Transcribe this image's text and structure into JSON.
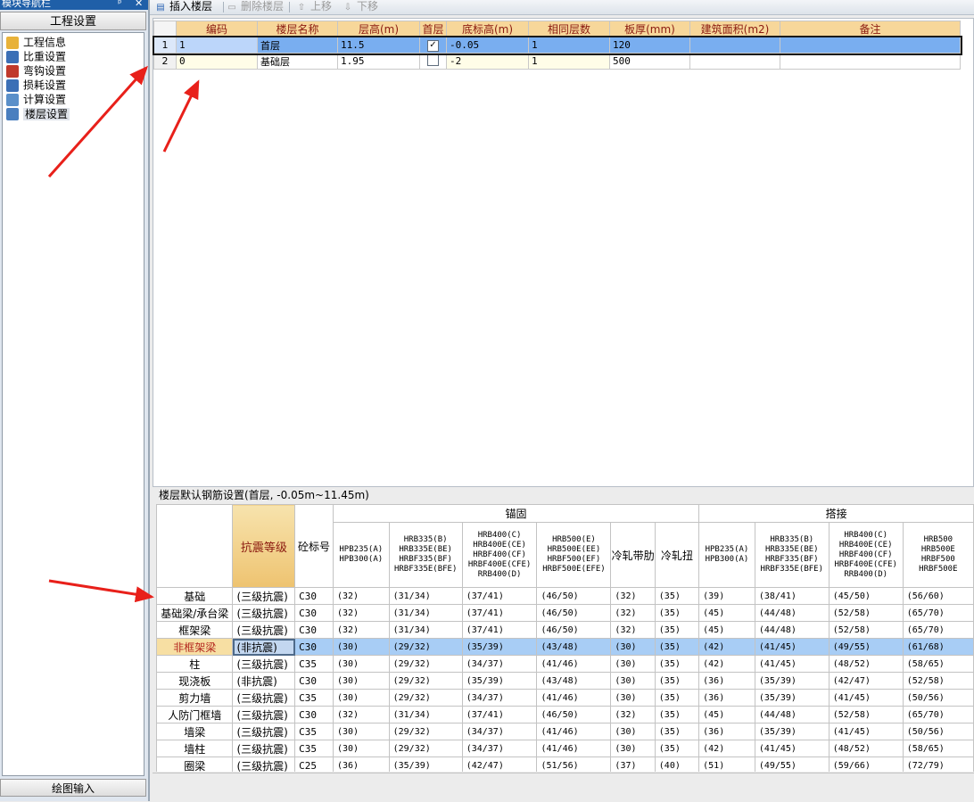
{
  "left_panel": {
    "title": "模块导航栏",
    "title_pin": "ᵖ",
    "title_close": "✕",
    "project_button": "工程设置",
    "tree_items": [
      {
        "label": "工程信息",
        "icon": "folder-info-icon",
        "color": "#e8b23a"
      },
      {
        "label": "比重设置",
        "icon": "weight-icon",
        "color": "#3b6fb6"
      },
      {
        "label": "弯钩设置",
        "icon": "hook-icon",
        "color": "#c0392b"
      },
      {
        "label": "损耗设置",
        "icon": "loss-icon",
        "color": "#3b6fb6"
      },
      {
        "label": "计算设置",
        "icon": "calc-icon",
        "color": "#5a8fc9"
      },
      {
        "label": "楼层设置",
        "icon": "floor-icon",
        "color": "#4a7fbf",
        "selected": true
      }
    ],
    "draw_button": "绘图输入"
  },
  "toolbar": {
    "insert_floor": "插入楼层",
    "delete_floor": "删除楼层",
    "move_up": "上移",
    "move_down": "下移"
  },
  "floor_table": {
    "columns": [
      "编码",
      "楼层名称",
      "层高(m)",
      "首层",
      "底标高(m)",
      "相同层数",
      "板厚(mm)",
      "建筑面积(m2)",
      "备注"
    ],
    "rows": [
      {
        "num": "1",
        "code": "1",
        "name": "首层",
        "height": "11.5",
        "first": true,
        "bottom": "-0.05",
        "same": "1",
        "thickness": "120",
        "area": "",
        "note": ""
      },
      {
        "num": "2",
        "code": "0",
        "name": "基础层",
        "height": "1.95",
        "first": false,
        "bottom": "-2",
        "same": "1",
        "thickness": "500",
        "area": "",
        "note": ""
      }
    ]
  },
  "rebar": {
    "title": "楼层默认钢筋设置(首层, -0.05m~11.45m)",
    "col_seismic": "抗震等级",
    "col_concrete": "砼标号",
    "group_anchor": "锚固",
    "group_lap": "搭接",
    "anchor_headers": [
      "HPB235(A)\nHPB300(A)",
      "HRB335(B)\nHRB335E(BE)\nHRBF335(BF)\nHRBF335E(BFE)",
      "HRB400(C)\nHRB400E(CE)\nHRBF400(CF)\nHRBF400E(CFE)\nRRB400(D)",
      "HRB500(E)\nHRB500E(EE)\nHRBF500(EF)\nHRBF500E(EFE)",
      "冷轧带肋",
      "冷轧扭"
    ],
    "lap_headers": [
      "HPB235(A)\nHPB300(A)",
      "HRB335(B)\nHRB335E(BE)\nHRBF335(BF)\nHRBF335E(BFE)",
      "HRB400(C)\nHRB400E(CE)\nHRBF400(CF)\nHRBF400E(CFE)\nRRB400(D)",
      "HRB500\nHRB500E\nHRBF500\nHRBF500E"
    ],
    "rows": [
      {
        "name": "基础",
        "seismic": "(三级抗震)",
        "concrete": "C30",
        "vals": [
          "(32)",
          "(31/34)",
          "(37/41)",
          "(46/50)",
          "(32)",
          "(35)",
          "(39)",
          "(38/41)",
          "(45/50)",
          "(56/60)"
        ]
      },
      {
        "name": "基础梁/承台梁",
        "seismic": "(三级抗震)",
        "concrete": "C30",
        "vals": [
          "(32)",
          "(31/34)",
          "(37/41)",
          "(46/50)",
          "(32)",
          "(35)",
          "(45)",
          "(44/48)",
          "(52/58)",
          "(65/70)"
        ]
      },
      {
        "name": "框架梁",
        "seismic": "(三级抗震)",
        "concrete": "C30",
        "vals": [
          "(32)",
          "(31/34)",
          "(37/41)",
          "(46/50)",
          "(32)",
          "(35)",
          "(45)",
          "(44/48)",
          "(52/58)",
          "(65/70)"
        ]
      },
      {
        "name": "非框架梁",
        "seismic": "(非抗震)",
        "concrete": "C30",
        "vals": [
          "(30)",
          "(29/32)",
          "(35/39)",
          "(43/48)",
          "(30)",
          "(35)",
          "(42)",
          "(41/45)",
          "(49/55)",
          "(61/68)"
        ],
        "highlight": true
      },
      {
        "name": "柱",
        "seismic": "(三级抗震)",
        "concrete": "C35",
        "vals": [
          "(30)",
          "(29/32)",
          "(34/37)",
          "(41/46)",
          "(30)",
          "(35)",
          "(42)",
          "(41/45)",
          "(48/52)",
          "(58/65)"
        ]
      },
      {
        "name": "现浇板",
        "seismic": "(非抗震)",
        "concrete": "C30",
        "vals": [
          "(30)",
          "(29/32)",
          "(35/39)",
          "(43/48)",
          "(30)",
          "(35)",
          "(36)",
          "(35/39)",
          "(42/47)",
          "(52/58)"
        ]
      },
      {
        "name": "剪力墙",
        "seismic": "(三级抗震)",
        "concrete": "C35",
        "vals": [
          "(30)",
          "(29/32)",
          "(34/37)",
          "(41/46)",
          "(30)",
          "(35)",
          "(36)",
          "(35/39)",
          "(41/45)",
          "(50/56)"
        ]
      },
      {
        "name": "人防门框墙",
        "seismic": "(三级抗震)",
        "concrete": "C30",
        "vals": [
          "(32)",
          "(31/34)",
          "(37/41)",
          "(46/50)",
          "(32)",
          "(35)",
          "(45)",
          "(44/48)",
          "(52/58)",
          "(65/70)"
        ]
      },
      {
        "name": "墙梁",
        "seismic": "(三级抗震)",
        "concrete": "C35",
        "vals": [
          "(30)",
          "(29/32)",
          "(34/37)",
          "(41/46)",
          "(30)",
          "(35)",
          "(36)",
          "(35/39)",
          "(41/45)",
          "(50/56)"
        ]
      },
      {
        "name": "墙柱",
        "seismic": "(三级抗震)",
        "concrete": "C35",
        "vals": [
          "(30)",
          "(29/32)",
          "(34/37)",
          "(41/46)",
          "(30)",
          "(35)",
          "(42)",
          "(41/45)",
          "(48/52)",
          "(58/65)"
        ]
      },
      {
        "name": "圈梁",
        "seismic": "(三级抗震)",
        "concrete": "C25",
        "vals": [
          "(36)",
          "(35/39)",
          "(42/47)",
          "(51/56)",
          "(37)",
          "(40)",
          "(51)",
          "(49/55)",
          "(59/66)",
          "(72/79)"
        ]
      }
    ]
  },
  "colors": {
    "header_bg": "#f7d79a",
    "header_text": "#8b1a10",
    "selected_row": "#79aef0",
    "highlight_row": "#a8cdf5",
    "annotation_arrow": "#e8201a"
  }
}
